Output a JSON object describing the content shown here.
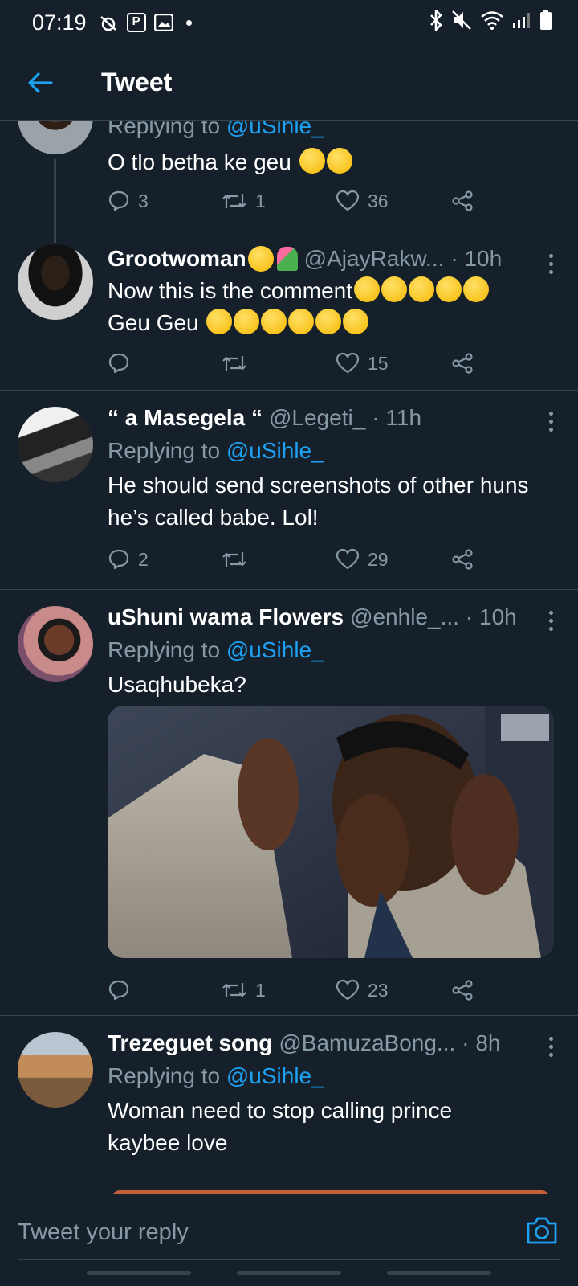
{
  "status_bar": {
    "time": "07:19"
  },
  "header": {
    "title": "Tweet"
  },
  "tweets": [
    {
      "reply_label": "Replying to",
      "reply_to": "@uSihle_",
      "text": "O tlo betha ke geu",
      "reply_count": "3",
      "retweet_count": "1",
      "like_count": "36"
    },
    {
      "name": "Grootwoman",
      "handle": "@AjayRakw...",
      "time": "· 10h",
      "text_line1": "Now this is the comment",
      "text_line2": "Geu Geu",
      "reply_count": "",
      "retweet_count": "",
      "like_count": "15"
    },
    {
      "name": "“ a Masegela “",
      "handle": "@Legeti_",
      "time": "· 11h",
      "reply_label": "Replying to",
      "reply_to": "@uSihle_",
      "text": "He should send screenshots of other huns he’s called babe. Lol!",
      "reply_count": "2",
      "retweet_count": "",
      "like_count": "29"
    },
    {
      "name": "uShuni wama Flowers",
      "handle": "@enhle_...",
      "time": "· 10h",
      "reply_label": "Replying to",
      "reply_to": "@uSihle_",
      "text": "Usaqhubeka?",
      "reply_count": "",
      "retweet_count": "1",
      "like_count": "23"
    },
    {
      "name": "Trezeguet song",
      "handle": "@BamuzaBong...",
      "time": "· 8h",
      "reply_label": "Replying to",
      "reply_to": "@uSihle_",
      "text": "Woman need to stop calling prince kaybee love"
    }
  ],
  "reply_bar": {
    "placeholder": "Tweet your reply"
  },
  "icons": {
    "back": "arrow-left-icon",
    "reply": "speech-bubble-icon",
    "retweet": "retweet-icon",
    "like": "heart-icon",
    "share": "share-icon",
    "more": "vertical-dots-icon",
    "camera": "camera-icon"
  },
  "colors": {
    "background": "#15202b",
    "accent": "#1da1f2",
    "secondary_text": "#8899a6",
    "divider": "#38444d"
  }
}
